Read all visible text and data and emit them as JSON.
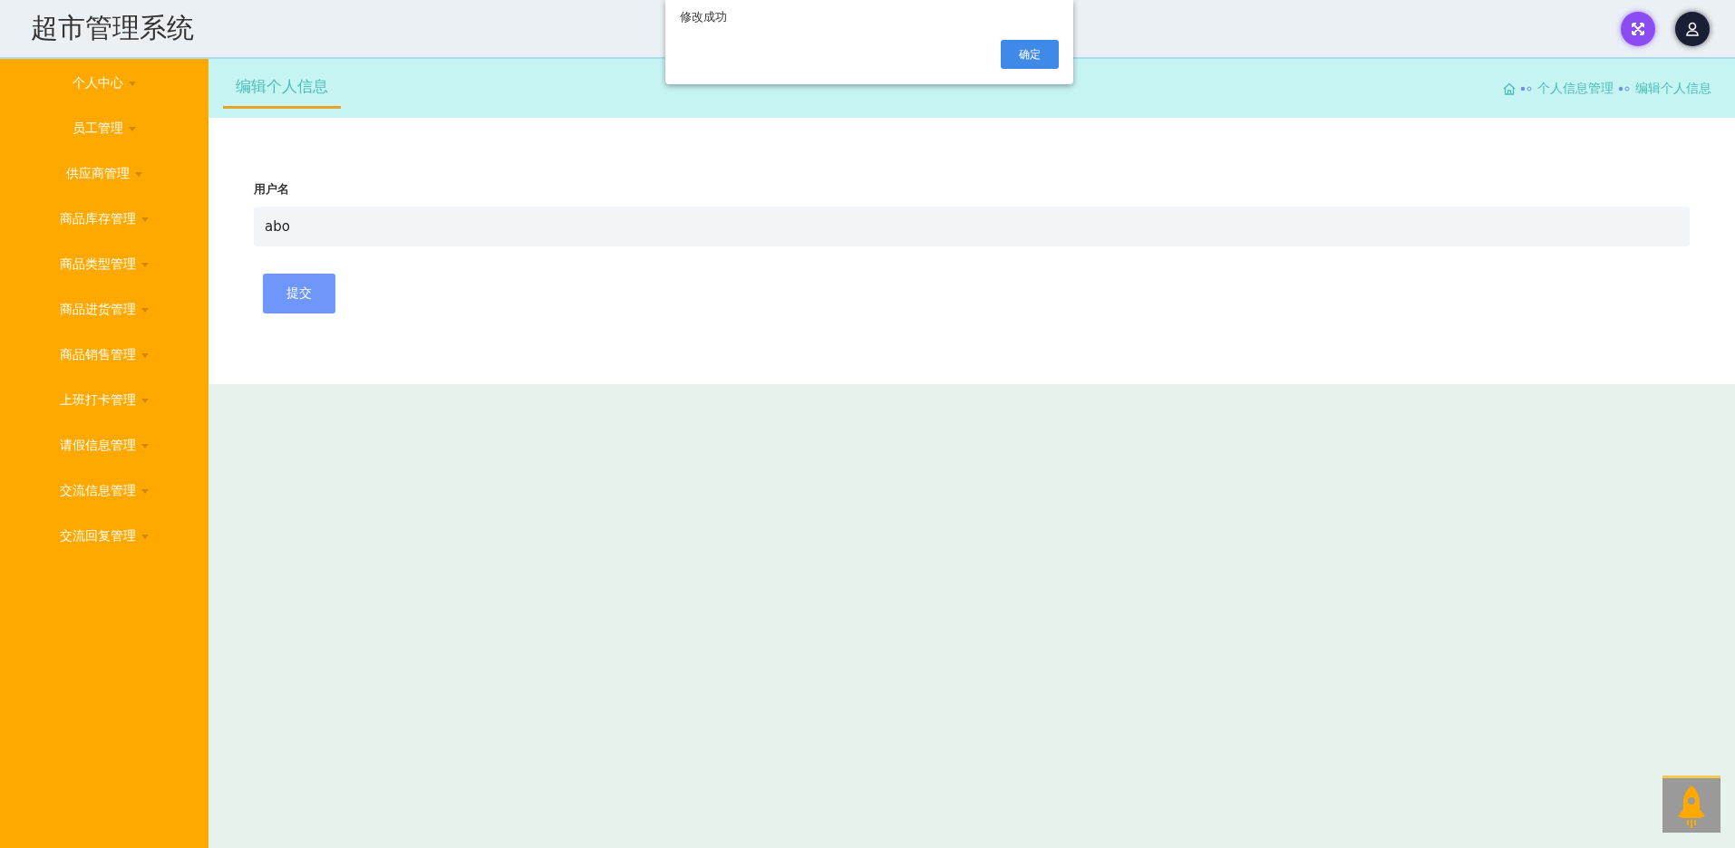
{
  "header": {
    "title": "超市管理系统"
  },
  "sidebar": {
    "items": [
      {
        "label": "个人中心"
      },
      {
        "label": "员工管理"
      },
      {
        "label": "供应商管理"
      },
      {
        "label": "商品库存管理"
      },
      {
        "label": "商品类型管理"
      },
      {
        "label": "商品进货管理"
      },
      {
        "label": "商品销售管理"
      },
      {
        "label": "上班打卡管理"
      },
      {
        "label": "请假信息管理"
      },
      {
        "label": "交流信息管理"
      },
      {
        "label": "交流回复管理"
      }
    ]
  },
  "tabs": [
    {
      "label": "编辑个人信息",
      "selected": true
    }
  ],
  "breadcrumb": [
    "个人信息管理",
    "编辑个人信息"
  ],
  "form": {
    "label": "用户名",
    "value": "abo",
    "submit": "提交"
  },
  "dialog": {
    "message": "修改成功",
    "button": "确定"
  }
}
